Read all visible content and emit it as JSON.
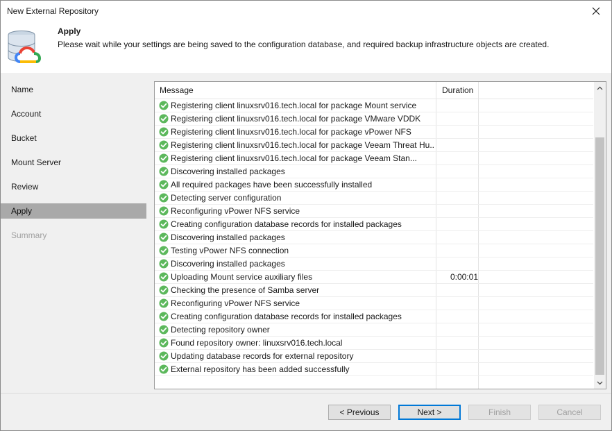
{
  "window": {
    "title": "New External Repository"
  },
  "header": {
    "title": "Apply",
    "description": "Please wait while your settings are being saved to the configuration database, and required backup infrastructure objects are created."
  },
  "steps": [
    {
      "label": "Name",
      "state": "normal"
    },
    {
      "label": "Account",
      "state": "normal"
    },
    {
      "label": "Bucket",
      "state": "normal"
    },
    {
      "label": "Mount Server",
      "state": "normal"
    },
    {
      "label": "Review",
      "state": "normal"
    },
    {
      "label": "Apply",
      "state": "active"
    },
    {
      "label": "Summary",
      "state": "disabled"
    }
  ],
  "log": {
    "columns": {
      "message": "Message",
      "duration": "Duration"
    },
    "rows": [
      {
        "message": "Registering client linuxsrv016.tech.local for package Mount service",
        "duration": ""
      },
      {
        "message": "Registering client linuxsrv016.tech.local for package VMware VDDK",
        "duration": ""
      },
      {
        "message": "Registering client linuxsrv016.tech.local for package vPower NFS",
        "duration": ""
      },
      {
        "message": "Registering client linuxsrv016.tech.local for package Veeam Threat Hu...",
        "duration": ""
      },
      {
        "message": "Registering client linuxsrv016.tech.local for package Veeam Stan...",
        "duration": ""
      },
      {
        "message": "Discovering installed packages",
        "duration": ""
      },
      {
        "message": "All required packages have been successfully installed",
        "duration": ""
      },
      {
        "message": "Detecting server configuration",
        "duration": ""
      },
      {
        "message": "Reconfiguring vPower NFS service",
        "duration": ""
      },
      {
        "message": "Creating configuration database records for installed packages",
        "duration": ""
      },
      {
        "message": "Discovering installed packages",
        "duration": ""
      },
      {
        "message": "Testing vPower NFS connection",
        "duration": ""
      },
      {
        "message": "Discovering installed packages",
        "duration": ""
      },
      {
        "message": "Uploading Mount service auxiliary files",
        "duration": "0:00:01"
      },
      {
        "message": "Checking the presence of Samba server",
        "duration": ""
      },
      {
        "message": "Reconfiguring vPower NFS service",
        "duration": ""
      },
      {
        "message": "Creating configuration database records for installed packages",
        "duration": ""
      },
      {
        "message": "Detecting repository owner",
        "duration": ""
      },
      {
        "message": "Found repository owner: linuxsrv016.tech.local",
        "duration": ""
      },
      {
        "message": "Updating database records for external repository",
        "duration": ""
      },
      {
        "message": "External repository has been added successfully",
        "duration": ""
      }
    ],
    "status_icon": "success-check-icon",
    "status_color": "#5cb85c"
  },
  "buttons": {
    "previous": "< Previous",
    "next": "Next >",
    "finish": "Finish",
    "cancel": "Cancel"
  }
}
